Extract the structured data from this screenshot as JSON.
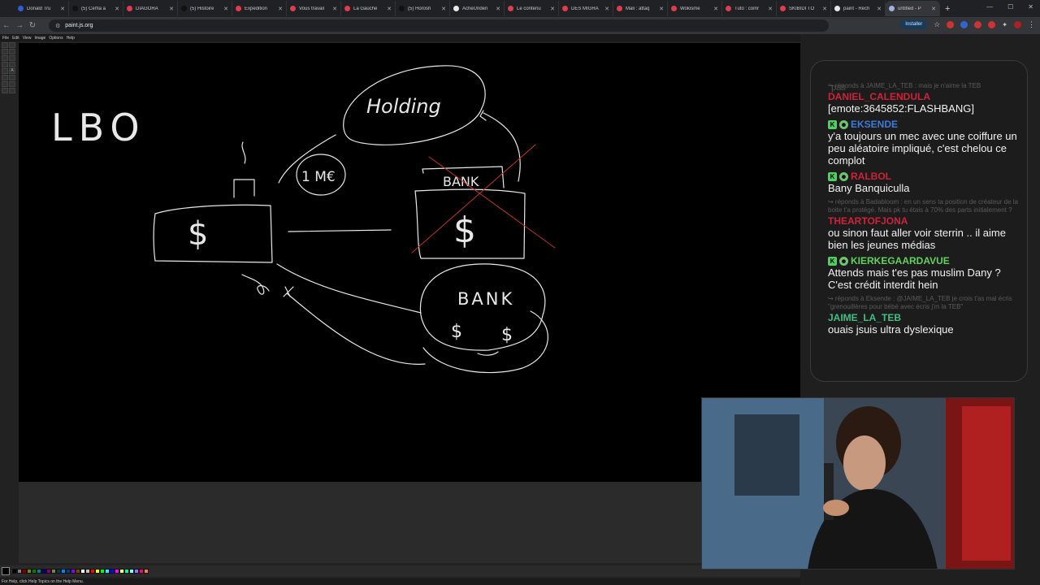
{
  "browser": {
    "tabs": [
      {
        "title": "Donald Tru",
        "color": "#2f5fd0"
      },
      {
        "title": "(5) Cerfia a",
        "color": "#111111"
      },
      {
        "title": "DIAGORA",
        "color": "#e03b4f"
      },
      {
        "title": "(5) Histoire",
        "color": "#111111"
      },
      {
        "title": "Expedition",
        "color": "#e03b4f"
      },
      {
        "title": "Vous travail",
        "color": "#e03b4f"
      },
      {
        "title": "La Gauche",
        "color": "#e03b4f"
      },
      {
        "title": "(5) Horosh",
        "color": "#111111"
      },
      {
        "title": "AcheUnden",
        "color": "#e8e8e8"
      },
      {
        "title": "Le contenu",
        "color": "#e03b4f"
      },
      {
        "title": "DES MIGRA",
        "color": "#e03b4f"
      },
      {
        "title": "Mali : attaq",
        "color": "#e03b4f"
      },
      {
        "title": "Wokisme",
        "color": "#e03b4f"
      },
      {
        "title": "Tuto : comr",
        "color": "#e03b4f"
      },
      {
        "title": "SKIBIDI TO",
        "color": "#e03b4f"
      },
      {
        "title": "paint - Rech",
        "color": "#e8e8e8"
      },
      {
        "title": "untitled - P",
        "color": "#9db3d8",
        "active": true
      }
    ],
    "url": "paint.js.org",
    "install_label": "Installer"
  },
  "paint": {
    "menu": [
      "File",
      "Edit",
      "View",
      "Image",
      "Options",
      "Help"
    ],
    "status": "For Help, click Help Topics on the Help Menu.",
    "palette": [
      "#000000",
      "#808080",
      "#800000",
      "#808000",
      "#008000",
      "#008080",
      "#000080",
      "#800080",
      "#808040",
      "#004040",
      "#0080ff",
      "#004080",
      "#8000ff",
      "#804000",
      "#ffffff",
      "#c0c0c0",
      "#ff0000",
      "#ffff00",
      "#00ff00",
      "#00ffff",
      "#0000ff",
      "#ff00ff",
      "#ffff80",
      "#00ff80",
      "#80ffff",
      "#8080ff",
      "#ff0080",
      "#ff8040"
    ],
    "drawing": {
      "lbo": "LBO",
      "holding": "Holding",
      "one_me": "1 M€",
      "bank_top": "BANK",
      "bank_bottom": "BANK",
      "dollar": "$"
    }
  },
  "chat": {
    "ghost": "'pas",
    "messages": [
      {
        "reply": "↪ réponds à JAIME_LA_TEB : mais je n'aime la TEB",
        "user": "DANIEL_CALENDULA",
        "color": "#d0213a",
        "badges": false,
        "text": "[emote:3645852:FLASHBANG]"
      },
      {
        "reply": "",
        "user": "EKSENDE",
        "color": "#3c7bd8",
        "badges": true,
        "text": "y'a toujours un mec avec une coiffure un peu aléatoire impliqué, c'est chelou ce complot"
      },
      {
        "reply": "",
        "user": "RALBOL",
        "color": "#d0213a",
        "badges": true,
        "text": "Bany Banquiculla"
      },
      {
        "reply": "↪ réponds à Badabloom : en un sens ta position de créateur de la boite t'a protégé. Mais pk tu étais à 70% des parts initialement ?",
        "user": "THEARTOFJONA",
        "color": "#d0213a",
        "badges": false,
        "text": "ou sinon faut aller voir sterrin .. il aime bien les jeunes médias"
      },
      {
        "reply": "",
        "user": "KIERKEGAARDAVUE",
        "color": "#5fd35a",
        "badges": true,
        "text": "Attends mais t'es pas muslim Dany ? C'est crédit interdit hein"
      },
      {
        "reply": "↪ réponds à Eksende : @JAIME_LA_TEB je crois t'as mal écris \"grenouillères pour bébé avec écris j'm la TEB\"",
        "user": "JAIME_LA_TEB",
        "color": "#3fbf86",
        "badges": false,
        "text": "ouais jsuis ultra dyslexique"
      }
    ]
  }
}
